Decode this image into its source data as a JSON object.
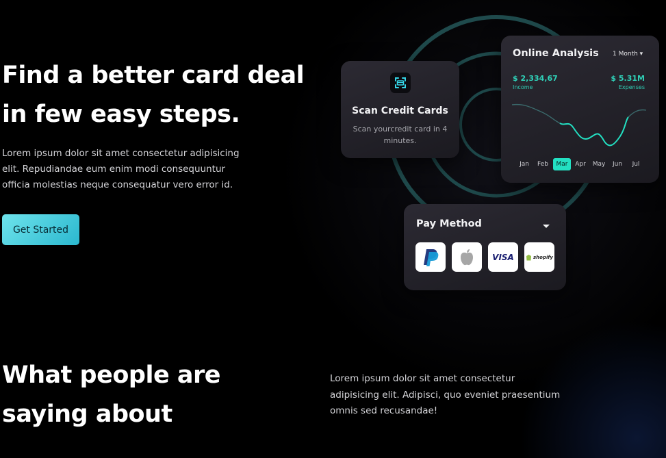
{
  "hero": {
    "title": "Find a better card deal\nin few easy steps.",
    "description": "Lorem ipsum dolor sit amet consectetur adipisicing elit. Repudiandae eum enim modi consequuntur officia molestias neque consequatur vero error id.",
    "cta_label": "Get Started"
  },
  "scan_card": {
    "title": "Scan Credit Cards",
    "description": "Scan yourcredit card in 4 minutes."
  },
  "analysis_card": {
    "title": "Online Analysis",
    "period": "1 Month",
    "income_value": "$ 2,334,67",
    "income_label": "Income",
    "expense_value": "$ 5.31M",
    "expense_label": "Expenses",
    "months": [
      "Jan",
      "Feb",
      "Mar",
      "Apr",
      "May",
      "Jun",
      "Jul"
    ],
    "active_month": "Mar",
    "accent_color": "#23e0c2"
  },
  "pay_card": {
    "title": "Pay Method",
    "options": [
      {
        "name": "PayPal",
        "icon": "paypal-icon"
      },
      {
        "name": "Apple Pay",
        "icon": "apple-icon"
      },
      {
        "name": "VISA",
        "icon": "visa-icon"
      },
      {
        "name": "shopify",
        "icon": "shopify-icon"
      }
    ]
  },
  "testimonials": {
    "title": "What people are\nsaying about",
    "description": "Lorem ipsum dolor sit amet consectetur adipisicing elit. Adipisci, quo eveniet praesentium omnis sed recusandae!"
  },
  "colors": {
    "cta_gradient_start": "#6ee3ec",
    "cta_gradient_end": "#2bb8cf",
    "ring_color": "#1f4a4c",
    "teal_text": "#2fd1b8"
  }
}
